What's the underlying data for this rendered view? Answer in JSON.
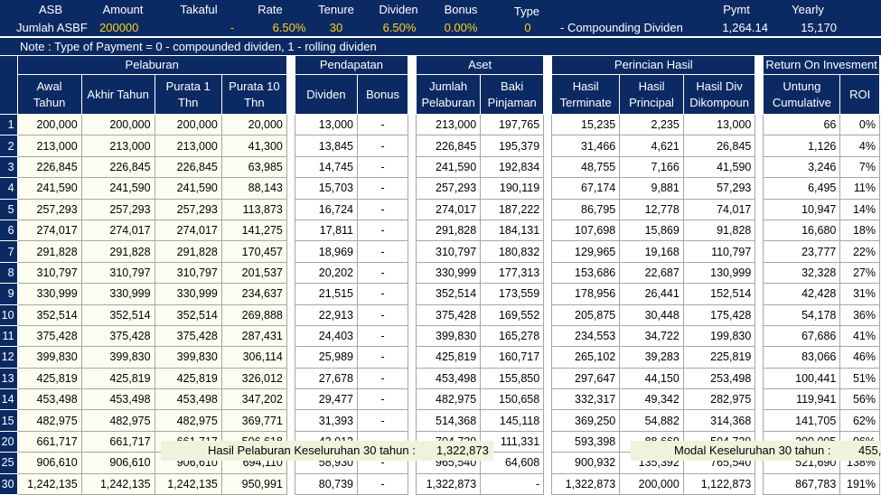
{
  "header": {
    "asb": "ASB",
    "amount": "Amount",
    "takaful": "Takaful",
    "rate": "Rate",
    "tenure": "Tenure",
    "dividen": "Dividen",
    "bonus": "Bonus",
    "type": "Type",
    "pymt": "Pymt",
    "yearly": "Yearly"
  },
  "params": {
    "label": "Jumlah ASBF",
    "amount": "200000",
    "takaful": "-",
    "rate": "6.50%",
    "tenure": "30",
    "dividen": "6.50%",
    "bonus": "0.00%",
    "type": "0",
    "type_desc": "- Compounding Dividen",
    "pymt": "1,264.14",
    "yearly": "15,170"
  },
  "note": "Note :  Type of Payment = 0 - compounded dividen,  1 - rolling dividen",
  "groups": {
    "pelaburan": "Pelaburan",
    "pendapatan": "Pendapatan",
    "aset": "Aset",
    "perincian": "Perincian Hasil",
    "return": "Return On Invesment"
  },
  "columns": {
    "awal": "Awal Tahun",
    "akhir": "Akhir Tahun",
    "purata1": "Purata 1 Thn",
    "purata10": "Purata 10 Thn",
    "dividen": "Dividen",
    "bonus": "Bonus",
    "jumlah": "Jumlah Pelaburan",
    "baki": "Baki Pinjaman",
    "terminate": "Hasil Terminate",
    "principal": "Hasil Principal",
    "hasildiv": "Hasil Div Dikompoun",
    "untung": "Untung Cumulative",
    "roi": "ROI"
  },
  "rows": [
    {
      "y": "1",
      "awal": "200,000",
      "akhir": "200,000",
      "p1": "200,000",
      "p10": "20,000",
      "div": "13,000",
      "bon": "-",
      "jum": "213,000",
      "baki": "197,765",
      "term": "15,235",
      "prin": "2,235",
      "hdiv": "13,000",
      "unt": "66",
      "roi": "0%"
    },
    {
      "y": "2",
      "awal": "213,000",
      "akhir": "213,000",
      "p1": "213,000",
      "p10": "41,300",
      "div": "13,845",
      "bon": "-",
      "jum": "226,845",
      "baki": "195,379",
      "term": "31,466",
      "prin": "4,621",
      "hdiv": "26,845",
      "unt": "1,126",
      "roi": "4%"
    },
    {
      "y": "3",
      "awal": "226,845",
      "akhir": "226,845",
      "p1": "226,845",
      "p10": "63,985",
      "div": "14,745",
      "bon": "-",
      "jum": "241,590",
      "baki": "192,834",
      "term": "48,755",
      "prin": "7,166",
      "hdiv": "41,590",
      "unt": "3,246",
      "roi": "7%"
    },
    {
      "y": "4",
      "awal": "241,590",
      "akhir": "241,590",
      "p1": "241,590",
      "p10": "88,143",
      "div": "15,703",
      "bon": "-",
      "jum": "257,293",
      "baki": "190,119",
      "term": "67,174",
      "prin": "9,881",
      "hdiv": "57,293",
      "unt": "6,495",
      "roi": "11%"
    },
    {
      "y": "5",
      "awal": "257,293",
      "akhir": "257,293",
      "p1": "257,293",
      "p10": "113,873",
      "div": "16,724",
      "bon": "-",
      "jum": "274,017",
      "baki": "187,222",
      "term": "86,795",
      "prin": "12,778",
      "hdiv": "74,017",
      "unt": "10,947",
      "roi": "14%"
    },
    {
      "y": "6",
      "awal": "274,017",
      "akhir": "274,017",
      "p1": "274,017",
      "p10": "141,275",
      "div": "17,811",
      "bon": "-",
      "jum": "291,828",
      "baki": "184,131",
      "term": "107,698",
      "prin": "15,869",
      "hdiv": "91,828",
      "unt": "16,680",
      "roi": "18%"
    },
    {
      "y": "7",
      "awal": "291,828",
      "akhir": "291,828",
      "p1": "291,828",
      "p10": "170,457",
      "div": "18,969",
      "bon": "-",
      "jum": "310,797",
      "baki": "180,832",
      "term": "129,965",
      "prin": "19,168",
      "hdiv": "110,797",
      "unt": "23,777",
      "roi": "22%"
    },
    {
      "y": "8",
      "awal": "310,797",
      "akhir": "310,797",
      "p1": "310,797",
      "p10": "201,537",
      "div": "20,202",
      "bon": "-",
      "jum": "330,999",
      "baki": "177,313",
      "term": "153,686",
      "prin": "22,687",
      "hdiv": "130,999",
      "unt": "32,328",
      "roi": "27%"
    },
    {
      "y": "9",
      "awal": "330,999",
      "akhir": "330,999",
      "p1": "330,999",
      "p10": "234,637",
      "div": "21,515",
      "bon": "-",
      "jum": "352,514",
      "baki": "173,559",
      "term": "178,956",
      "prin": "26,441",
      "hdiv": "152,514",
      "unt": "42,428",
      "roi": "31%"
    },
    {
      "y": "10",
      "awal": "352,514",
      "akhir": "352,514",
      "p1": "352,514",
      "p10": "269,888",
      "div": "22,913",
      "bon": "-",
      "jum": "375,428",
      "baki": "169,552",
      "term": "205,875",
      "prin": "30,448",
      "hdiv": "175,428",
      "unt": "54,178",
      "roi": "36%"
    },
    {
      "y": "11",
      "awal": "375,428",
      "akhir": "375,428",
      "p1": "375,428",
      "p10": "287,431",
      "div": "24,403",
      "bon": "-",
      "jum": "399,830",
      "baki": "165,278",
      "term": "234,553",
      "prin": "34,722",
      "hdiv": "199,830",
      "unt": "67,686",
      "roi": "41%"
    },
    {
      "y": "12",
      "awal": "399,830",
      "akhir": "399,830",
      "p1": "399,830",
      "p10": "306,114",
      "div": "25,989",
      "bon": "-",
      "jum": "425,819",
      "baki": "160,717",
      "term": "265,102",
      "prin": "39,283",
      "hdiv": "225,819",
      "unt": "83,066",
      "roi": "46%"
    },
    {
      "y": "13",
      "awal": "425,819",
      "akhir": "425,819",
      "p1": "425,819",
      "p10": "326,012",
      "div": "27,678",
      "bon": "-",
      "jum": "453,498",
      "baki": "155,850",
      "term": "297,647",
      "prin": "44,150",
      "hdiv": "253,498",
      "unt": "100,441",
      "roi": "51%"
    },
    {
      "y": "14",
      "awal": "453,498",
      "akhir": "453,498",
      "p1": "453,498",
      "p10": "347,202",
      "div": "29,477",
      "bon": "-",
      "jum": "482,975",
      "baki": "150,658",
      "term": "332,317",
      "prin": "49,342",
      "hdiv": "282,975",
      "unt": "119,941",
      "roi": "56%"
    },
    {
      "y": "15",
      "awal": "482,975",
      "akhir": "482,975",
      "p1": "482,975",
      "p10": "369,771",
      "div": "31,393",
      "bon": "-",
      "jum": "514,368",
      "baki": "145,118",
      "term": "369,250",
      "prin": "54,882",
      "hdiv": "314,368",
      "unt": "141,705",
      "roi": "62%"
    },
    {
      "y": "20",
      "awal": "661,717",
      "akhir": "661,717",
      "p1": "661,717",
      "p10": "506,618",
      "div": "43,012",
      "bon": "-",
      "jum": "704,729",
      "baki": "111,331",
      "term": "593,398",
      "prin": "88,669",
      "hdiv": "504,729",
      "unt": "290,005",
      "roi": "96%"
    },
    {
      "y": "25",
      "awal": "906,610",
      "akhir": "906,610",
      "p1": "906,610",
      "p10": "694,110",
      "div": "58,930",
      "bon": "-",
      "jum": "965,540",
      "baki": "64,608",
      "term": "900,932",
      "prin": "135,392",
      "hdiv": "765,540",
      "unt": "521,690",
      "roi": "138%"
    },
    {
      "y": "30",
      "awal": "1,242,135",
      "akhir": "1,242,135",
      "p1": "1,242,135",
      "p10": "950,991",
      "div": "80,739",
      "bon": "-",
      "jum": "1,322,873",
      "baki": "-",
      "term": "1,322,873",
      "prin": "200,000",
      "hdiv": "1,122,873",
      "unt": "867,783",
      "roi": "191%"
    }
  ],
  "footer": {
    "hasil_label": "Hasil Pelaburan Keseluruhan 30 tahun :",
    "hasil_value": "1,322,873",
    "modal_label": "Modal Keseluruhan 30 tahun :",
    "modal_value": "455,"
  },
  "colors": {
    "navy": "#0b2a63",
    "yellow": "#ffd21f",
    "footer_bg": "#eef3dd"
  }
}
